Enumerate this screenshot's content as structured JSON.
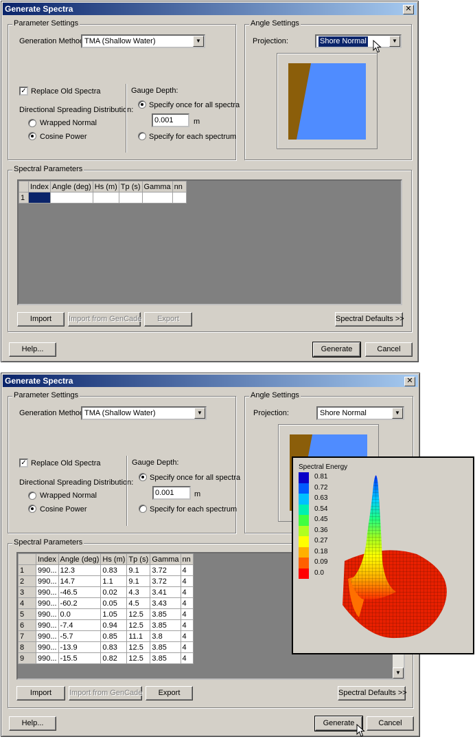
{
  "window_title": "Generate Spectra",
  "close_glyph": "✕",
  "param_group": "Parameter Settings",
  "gen_method_label": "Generation Method:",
  "gen_method_value": "TMA (Shallow Water)",
  "replace_label": "Replace Old Spectra",
  "replace_check": "✓",
  "spread_label": "Directional Spreading Distribution:",
  "wrapped_label": "Wrapped Normal",
  "cosine_label": "Cosine Power",
  "gauge_label": "Gauge Depth:",
  "specify_once_label": "Specify once for all spectra",
  "depth_value": "0.001",
  "depth_unit": "m",
  "specify_each_label": "Specify for each spectrum",
  "angle_group": "Angle Settings",
  "projection_label": "Projection:",
  "projection_value": "Shore Normal",
  "spectral_group": "Spectral Parameters",
  "columns": [
    "Index",
    "Angle (deg)",
    "Hs (m)",
    "Tp (s)",
    "Gamma",
    "nn"
  ],
  "top_rows": [
    [
      "1",
      "",
      "",
      "",
      "",
      "",
      ""
    ]
  ],
  "rows": [
    [
      "1",
      "990...",
      "12.3",
      "0.83",
      "9.1",
      "3.72",
      "4"
    ],
    [
      "2",
      "990...",
      "14.7",
      "1.1",
      "9.1",
      "3.72",
      "4"
    ],
    [
      "3",
      "990...",
      "-46.5",
      "0.02",
      "4.3",
      "3.41",
      "4"
    ],
    [
      "4",
      "990...",
      "-60.2",
      "0.05",
      "4.5",
      "3.43",
      "4"
    ],
    [
      "5",
      "990...",
      "0.0",
      "1.05",
      "12.5",
      "3.85",
      "4"
    ],
    [
      "6",
      "990...",
      "-7.4",
      "0.94",
      "12.5",
      "3.85",
      "4"
    ],
    [
      "7",
      "990...",
      "-5.7",
      "0.85",
      "11.1",
      "3.8",
      "4"
    ],
    [
      "8",
      "990...",
      "-13.9",
      "0.83",
      "12.5",
      "3.85",
      "4"
    ],
    [
      "9",
      "990...",
      "-15.5",
      "0.82",
      "12.5",
      "3.85",
      "4"
    ]
  ],
  "import_label": "Import",
  "import_gencade_label": "Import from GenCade",
  "export_label": "Export",
  "spectral_defaults_label": "Spectral Defaults >>",
  "help_label": "Help...",
  "generate_label": "Generate",
  "cancel_label": "Cancel",
  "legend_title": "Spectral Energy",
  "legend_values": [
    "0.81",
    "0.72",
    "0.63",
    "0.54",
    "0.45",
    "0.36",
    "0.27",
    "0.18",
    "0.09",
    "0.0"
  ],
  "legend_colors": [
    "#0a00c8",
    "#005aff",
    "#00c0ff",
    "#00f0b0",
    "#40ff40",
    "#b0ff20",
    "#ffff00",
    "#ffb000",
    "#ff6000",
    "#ff0000"
  ],
  "shore_color": "#8b5e0a",
  "water_color": "#4f8cff",
  "icons": [
    "close-icon",
    "dropdown-arrow-icon",
    "mouse-cursor-icon",
    "scroll-down-arrow-icon"
  ]
}
